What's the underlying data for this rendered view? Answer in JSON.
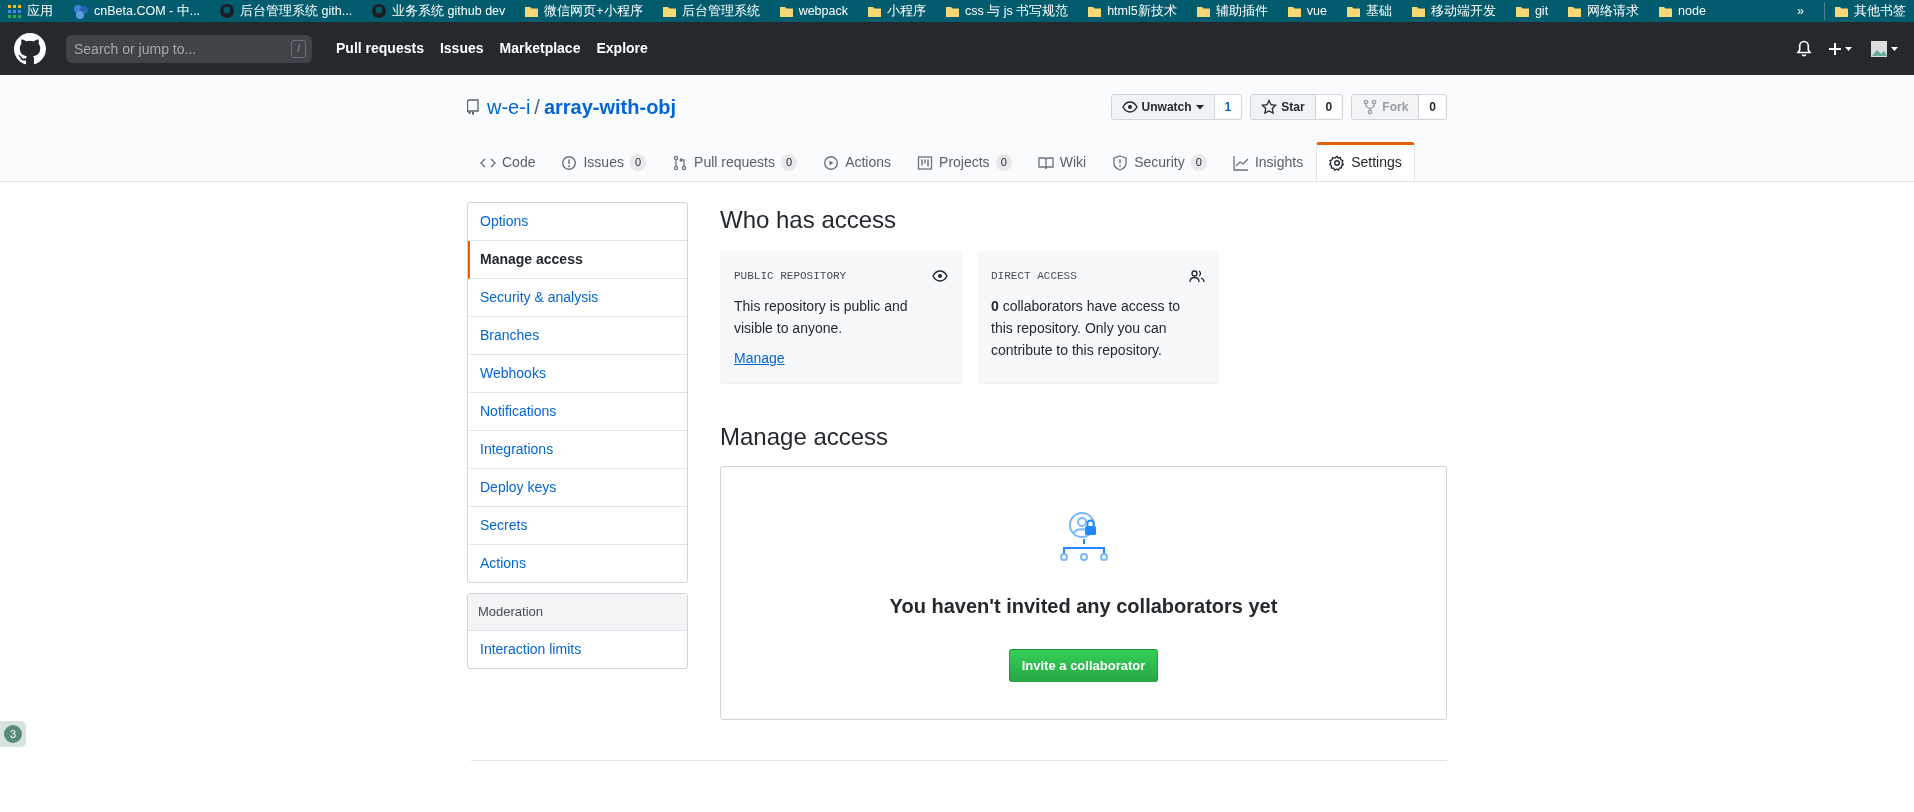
{
  "bookmarks": [
    {
      "kind": "apps",
      "label": "应用"
    },
    {
      "kind": "site",
      "label": "cnBeta.COM - 中..."
    },
    {
      "kind": "github",
      "label": "后台管理系统 gith..."
    },
    {
      "kind": "github",
      "label": "业务系统 github dev"
    },
    {
      "kind": "folder",
      "label": "微信网页+小程序"
    },
    {
      "kind": "folder",
      "label": "后台管理系统"
    },
    {
      "kind": "folder",
      "label": "webpack"
    },
    {
      "kind": "folder",
      "label": "小程序"
    },
    {
      "kind": "folder",
      "label": "css 与 js 书写规范"
    },
    {
      "kind": "folder",
      "label": "html5新技术"
    },
    {
      "kind": "folder",
      "label": "辅助插件"
    },
    {
      "kind": "folder",
      "label": "vue"
    },
    {
      "kind": "folder",
      "label": "基础"
    },
    {
      "kind": "folder",
      "label": "移动端开发"
    },
    {
      "kind": "folder",
      "label": "git"
    },
    {
      "kind": "folder",
      "label": "网络请求"
    },
    {
      "kind": "folder",
      "label": "node"
    }
  ],
  "bookmarks_more": "»",
  "bookmarks_other": "其他书签",
  "header": {
    "search_placeholder": "Search or jump to...",
    "search_key": "/",
    "nav": [
      "Pull requests",
      "Issues",
      "Marketplace",
      "Explore"
    ]
  },
  "repo": {
    "owner": "w-e-i",
    "separator": "/",
    "name": "array-with-obj",
    "actions": [
      {
        "kind": "watch",
        "label": "Unwatch",
        "count": "1",
        "disabled": false
      },
      {
        "kind": "star",
        "label": "Star",
        "count": "0",
        "disabled": false
      },
      {
        "kind": "fork",
        "label": "Fork",
        "count": "0",
        "disabled": true
      }
    ]
  },
  "tabs": [
    {
      "kind": "code",
      "label": "Code",
      "selected": false
    },
    {
      "kind": "issue",
      "label": "Issues",
      "count": "0",
      "selected": false
    },
    {
      "kind": "pr",
      "label": "Pull requests",
      "count": "0",
      "selected": false
    },
    {
      "kind": "play",
      "label": "Actions",
      "selected": false
    },
    {
      "kind": "project",
      "label": "Projects",
      "count": "0",
      "selected": false
    },
    {
      "kind": "book",
      "label": "Wiki",
      "selected": false
    },
    {
      "kind": "shield",
      "label": "Security",
      "count": "0",
      "selected": false
    },
    {
      "kind": "graph",
      "label": "Insights",
      "selected": false
    },
    {
      "kind": "gear",
      "label": "Settings",
      "selected": true
    }
  ],
  "sidebar": {
    "groups": [
      {
        "items": [
          {
            "label": "Options",
            "selected": false
          },
          {
            "label": "Manage access",
            "selected": true
          },
          {
            "label": "Security & analysis",
            "selected": false
          },
          {
            "label": "Branches",
            "selected": false
          },
          {
            "label": "Webhooks",
            "selected": false
          },
          {
            "label": "Notifications",
            "selected": false
          },
          {
            "label": "Integrations",
            "selected": false
          },
          {
            "label": "Deploy keys",
            "selected": false
          },
          {
            "label": "Secrets",
            "selected": false
          },
          {
            "label": "Actions",
            "selected": false
          }
        ]
      },
      {
        "heading": "Moderation",
        "items": [
          {
            "label": "Interaction limits",
            "selected": false
          }
        ]
      }
    ]
  },
  "who_has_access": {
    "title": "Who has access",
    "cards": [
      {
        "kind": "eye",
        "heading": "PUBLIC REPOSITORY",
        "text": "This repository is public and visible to anyone.",
        "link": "Manage"
      },
      {
        "kind": "people",
        "heading": "DIRECT ACCESS",
        "text": "**0** collaborators have access to this repository. Only you can contribute to this repository."
      }
    ]
  },
  "manage_access": {
    "title": "Manage access",
    "empty_text": "You haven't invited any collaborators yet",
    "button": "Invite a collaborator"
  },
  "floating_badge": "3"
}
